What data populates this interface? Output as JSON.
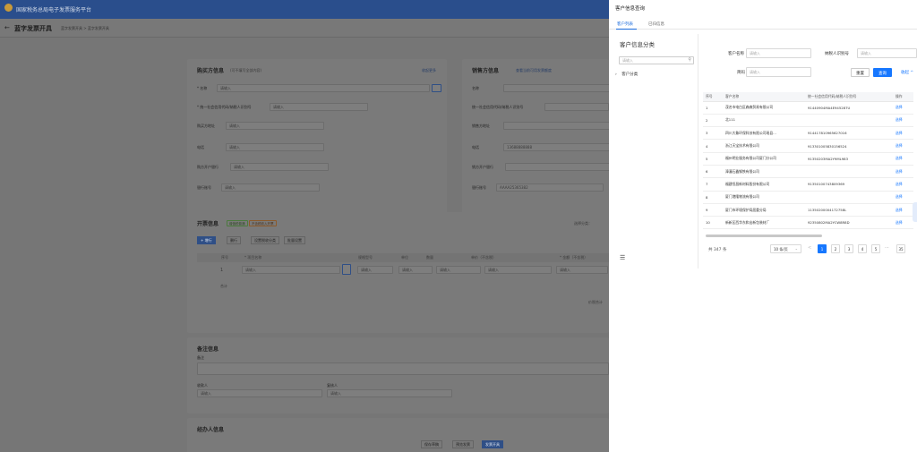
{
  "app": {
    "title": "国家税务总局电子发票服务平台"
  },
  "header": {
    "page_title": "蓝字发票开具",
    "back": "←",
    "crumbs": "蓝字发票开具  >  蓝字发票开具"
  },
  "buyer": {
    "title": "购买方信息",
    "hint": "(可不填写全部内容)",
    "more": "收起更多",
    "fields": [
      {
        "label": "* 名称",
        "placeholder": "请输入"
      },
      {
        "label": "* 统一社会信用代码/纳税人识别号",
        "placeholder": "请输入"
      },
      {
        "label": "购买方地址",
        "placeholder": "请输入"
      },
      {
        "label": "电话",
        "placeholder": "请输入"
      },
      {
        "label": "购方开户银行",
        "placeholder": "请输入"
      },
      {
        "label": "银行账号",
        "placeholder": "请输入"
      }
    ]
  },
  "seller": {
    "title": "销售方信息",
    "link": "查看当前可用发票额度",
    "fields": [
      {
        "label": "名称",
        "value": ""
      },
      {
        "label": "统一社会信用代码/纳税人识别号",
        "value": ""
      },
      {
        "label": "销售方地址",
        "value": ""
      },
      {
        "label": "电话",
        "value": "13688888888"
      },
      {
        "label": "销方开户银行",
        "value": ""
      },
      {
        "label": "银行账号",
        "value": "AAAA25365382"
      }
    ]
  },
  "items": {
    "title": "开票信息",
    "tags": [
      "增值税普通",
      "不含税收入开票"
    ],
    "buttons": [
      "+ 增行",
      "删行",
      "设置税收分类",
      "批量设置"
    ],
    "right_note": "选择分类：",
    "columns": [
      "序号",
      "* 项目名称",
      "规格型号",
      "单位",
      "数量",
      "单价（不含税）",
      "* 金额（不含税）"
    ],
    "row_index": "1",
    "row_placeholder": "请输入",
    "total_label": "合计",
    "sum_label": "价税合计"
  },
  "remark": {
    "title": "备注信息",
    "label": "备注",
    "payee": "收款人",
    "checker": "复核人",
    "placeholder": "请输入"
  },
  "agent": {
    "title": "经办人信息"
  },
  "footer": {
    "buttons": [
      "保存草稿",
      "预览发票",
      "发票开具"
    ]
  },
  "drawer": {
    "title": "客户信息查询",
    "tabs": [
      "客户列表",
      "已归信息"
    ],
    "left_title": "客户信息分类",
    "search_placeholder": "请输入",
    "tree_node": "客户分类",
    "filters": {
      "name_label": "客户名称",
      "taxid_label": "纳税人识别号",
      "abbr_label": "简码",
      "placeholder": "请输入",
      "reset": "重置",
      "query": "查询",
      "collapse": "收起 ^"
    },
    "columns": [
      "序号",
      "客户名称",
      "统一社会信用代码/纳税人识别号",
      "操作"
    ],
    "rows": [
      {
        "no": "1",
        "name": "茂名市电白区森森贸易有限公司",
        "id": "91440904MA4E945287U",
        "op": "选择"
      },
      {
        "no": "2",
        "name": "北111",
        "id": "",
        "op": "选择"
      },
      {
        "no": "3",
        "name": "四川大象环保科技有限公司瑶县…",
        "id": "914417810965627016",
        "op": "选择"
      },
      {
        "no": "4",
        "name": "浙江天宝技术有限公司",
        "id": "913301005830156524",
        "op": "选择"
      },
      {
        "no": "5",
        "name": "福州明业服务有限公司厦门分公司",
        "id": "91350203MA2Y9ML983",
        "op": "选择"
      },
      {
        "no": "6",
        "name": "漳潼石鑫钢铁有限公司",
        "id": "",
        "op": "选择"
      },
      {
        "no": "7",
        "name": "福建恒昌新材料股份有限公司",
        "id": "91350100743809369",
        "op": "选择"
      },
      {
        "no": "8",
        "name": "厦门港隆物流有限公司",
        "id": "",
        "op": "选择"
      },
      {
        "no": "9",
        "name": "厦门市环境保护局居委分局",
        "id": "11350200004172758L",
        "op": "选择"
      },
      {
        "no": "10",
        "name": "新新区西华东和出新包装材厂",
        "id": "92350802MA2YCW8R8D",
        "op": "选择"
      }
    ],
    "pagination": {
      "total": "共 347 条",
      "size": "10 条/页",
      "prev": "<",
      "pages": [
        "1",
        "2",
        "3",
        "4",
        "5"
      ],
      "dots": "···",
      "last": "35",
      "next": ">"
    },
    "menu_icon": "☰"
  }
}
